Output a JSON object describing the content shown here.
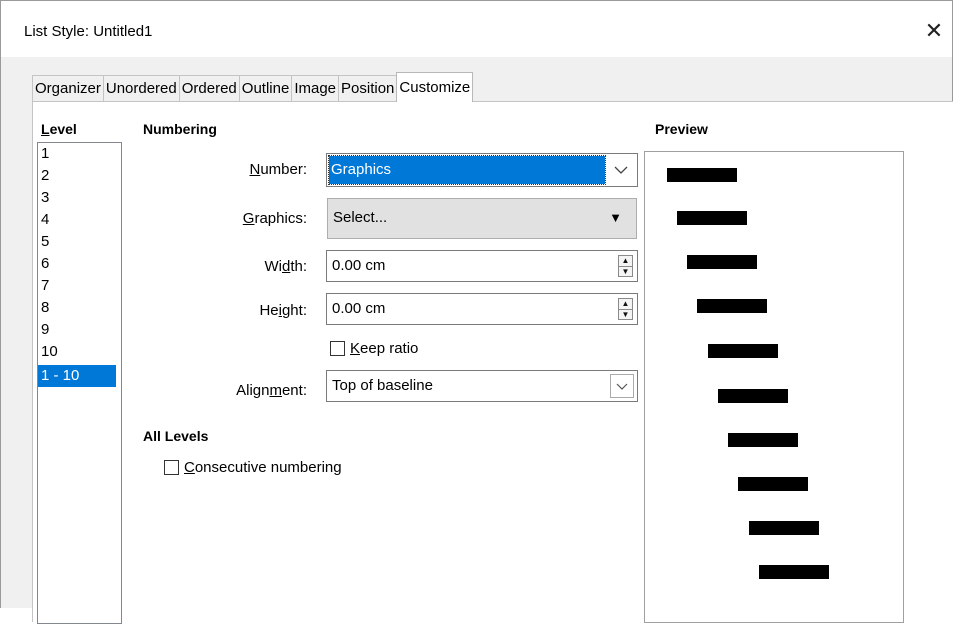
{
  "window": {
    "title": "List Style: Untitled1",
    "close_glyph": "✕"
  },
  "tabs": [
    "Organizer",
    "Unordered",
    "Ordered",
    "Outline",
    "Image",
    "Position",
    "Customize"
  ],
  "active_tab": "Customize",
  "level": {
    "heading": "Level",
    "items": [
      "1",
      "2",
      "3",
      "4",
      "5",
      "6",
      "7",
      "8",
      "9",
      "10",
      "1 - 10"
    ],
    "selected": "1 - 10"
  },
  "numbering": {
    "heading": "Numbering",
    "number_label": "Number:",
    "number_value": "Graphics",
    "graphics_label": "Graphics:",
    "graphics_button": "Select...",
    "width_label": "Width:",
    "width_value": "0.00 cm",
    "height_label": "Height:",
    "height_value": "0.00 cm",
    "keep_ratio_label": "Keep ratio",
    "keep_ratio_checked": false,
    "alignment_label": "Alignment:",
    "alignment_value": "Top of baseline"
  },
  "all_levels": {
    "heading": "All Levels",
    "consecutive_label": "Consecutive numbering",
    "consecutive_checked": false
  },
  "preview": {
    "heading": "Preview",
    "bar_count": 10
  },
  "colors": {
    "selection": "#0078d7",
    "dialog_bg": "#f0f0f0"
  }
}
